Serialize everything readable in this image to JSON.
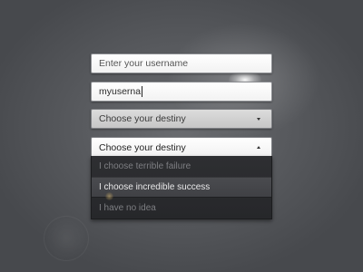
{
  "username_field": {
    "placeholder": "Enter your username"
  },
  "filled_field": {
    "value": "myuserna"
  },
  "destiny_select_closed": {
    "label": "Choose your destiny",
    "icon": "chevron-down-icon"
  },
  "destiny_select_open": {
    "label": "Choose your destiny",
    "icon": "chevron-up-icon",
    "options": [
      {
        "label": "I choose terrible failure"
      },
      {
        "label": "I choose incredible success",
        "selected": true
      },
      {
        "label": "I have no idea"
      }
    ]
  }
}
